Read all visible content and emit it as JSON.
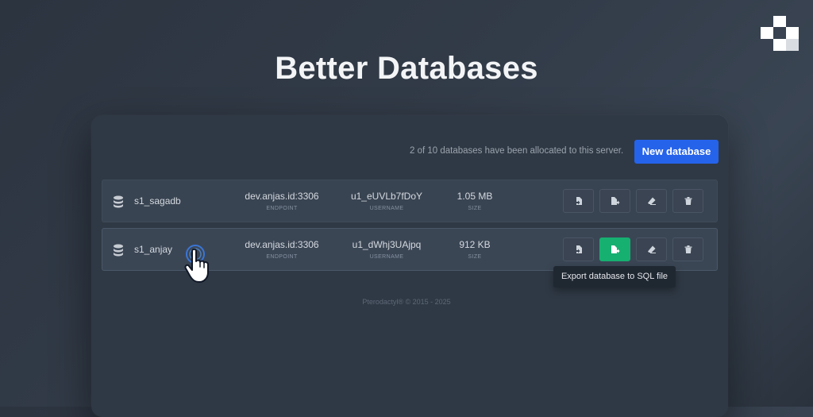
{
  "headline": "Better Databases",
  "allocation_text": "2 of 10 databases have been allocated to this server.",
  "new_database_label": "New database",
  "labels": {
    "endpoint": "ENDPOINT",
    "username": "USERNAME",
    "size": "SIZE"
  },
  "databases": [
    {
      "name": "s1_sagadb",
      "endpoint": "dev.anjas.id:3306",
      "username": "u1_eUVLb7fDoY",
      "size": "1.05 MB"
    },
    {
      "name": "s1_anjay",
      "endpoint": "dev.anjas.id:3306",
      "username": "u1_dWhj3UAjpq",
      "size": "912 KB"
    }
  ],
  "tooltip": "Export database to SQL file",
  "footer": "Pterodactyl® © 2015 - 2025",
  "colors": {
    "primary": "#2563eb",
    "success": "#16b071"
  },
  "icons": [
    "logo-icon",
    "database-icon",
    "import-icon",
    "export-icon",
    "eraser-icon",
    "trash-icon",
    "hand-pointer-icon"
  ]
}
